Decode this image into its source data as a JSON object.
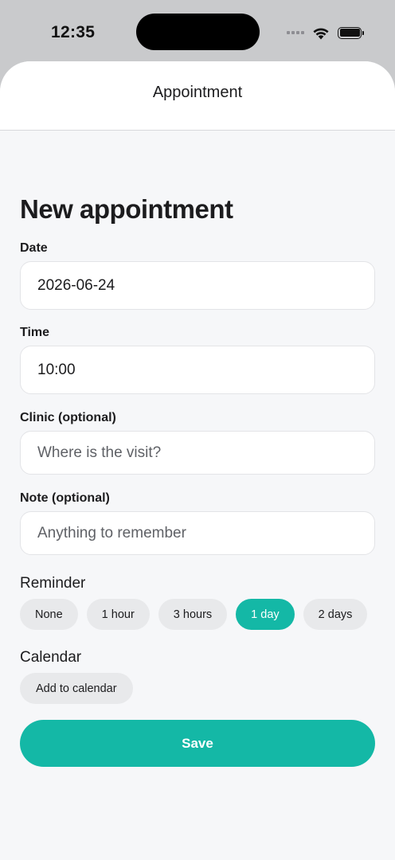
{
  "status_bar": {
    "time": "12:35",
    "icons": [
      "signal-dots-icon",
      "wifi-icon",
      "battery-icon"
    ]
  },
  "header": {
    "title": "Appointment"
  },
  "form": {
    "heading": "New appointment",
    "date": {
      "label": "Date",
      "value": "2026-06-24"
    },
    "time": {
      "label": "Time",
      "value": "10:00"
    },
    "clinic": {
      "label": "Clinic (optional)",
      "placeholder": "Where is the visit?"
    },
    "note": {
      "label": "Note (optional)",
      "placeholder": "Anything to remember"
    },
    "reminder": {
      "label": "Reminder",
      "options": [
        "None",
        "1 hour",
        "3 hours",
        "1 day",
        "2 days"
      ],
      "selected": "1 day"
    },
    "calendar": {
      "label": "Calendar",
      "button": "Add to calendar"
    },
    "save_label": "Save"
  },
  "colors": {
    "accent": "#14b8a6",
    "background": "#f6f7f9",
    "chip": "#e8e9eb"
  }
}
